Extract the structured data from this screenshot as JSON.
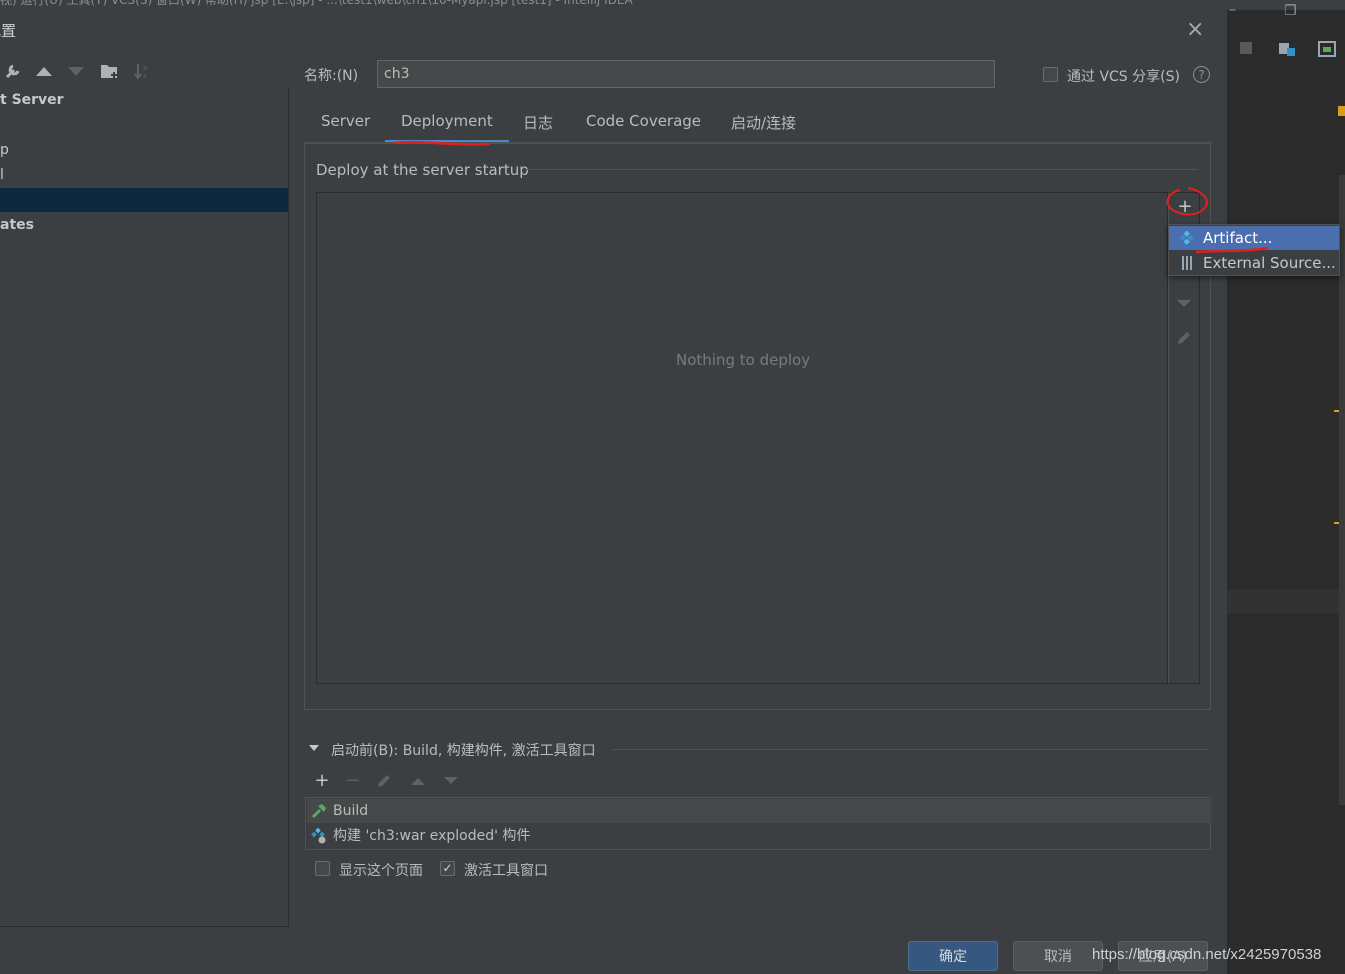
{
  "ide": {
    "menu_text": "视)  运行(U)  工具(T)  VCS(S)  窗口(W)  帮助(H)  jsp [E:\\jsp] - ...\\test1\\web\\ch1\\10-Myapl.jsp [test1] - IntelliJ IDEA"
  },
  "dialog": {
    "title": "配置",
    "close_label": "×"
  },
  "tree": {
    "items": [
      {
        "label": "t Server"
      },
      {
        "label": "p"
      },
      {
        "label": "l"
      },
      {
        "label": ""
      },
      {
        "label": "ates"
      }
    ]
  },
  "config": {
    "name_label": "名称:(N)",
    "name_value": "ch3",
    "vcs_share_label": "通过 VCS 分享(S)",
    "help_label": "?"
  },
  "tabs": [
    {
      "label": "Server"
    },
    {
      "label": "Deployment"
    },
    {
      "label": "日志"
    },
    {
      "label": "Code Coverage"
    },
    {
      "label": "启动/连接"
    }
  ],
  "deployment": {
    "header": "Deploy at the server startup",
    "empty_text": "Nothing to deploy",
    "add_label": "+"
  },
  "popup": {
    "items": [
      {
        "label": "Artifact..."
      },
      {
        "label": "External Source..."
      }
    ]
  },
  "before_launch": {
    "header": "启动前(B): Build, 构建构件, 激活工具窗口",
    "items": [
      {
        "label": "Build"
      },
      {
        "label": "构建 'ch3:war exploded' 构件"
      }
    ]
  },
  "options": {
    "show_page_label": "显示这个页面",
    "show_page_checked": false,
    "activate_tool_label": "激活工具窗口",
    "activate_tool_checked": true
  },
  "buttons": {
    "ok": "确定",
    "cancel": "取消",
    "apply": "应用(A)"
  },
  "watermark": "https://blog.csdn.net/x2425970538",
  "colors": {
    "accent": "#4a88c7",
    "selection": "#4b6eaf",
    "default_button": "#365880",
    "annotation": "#e02020"
  }
}
